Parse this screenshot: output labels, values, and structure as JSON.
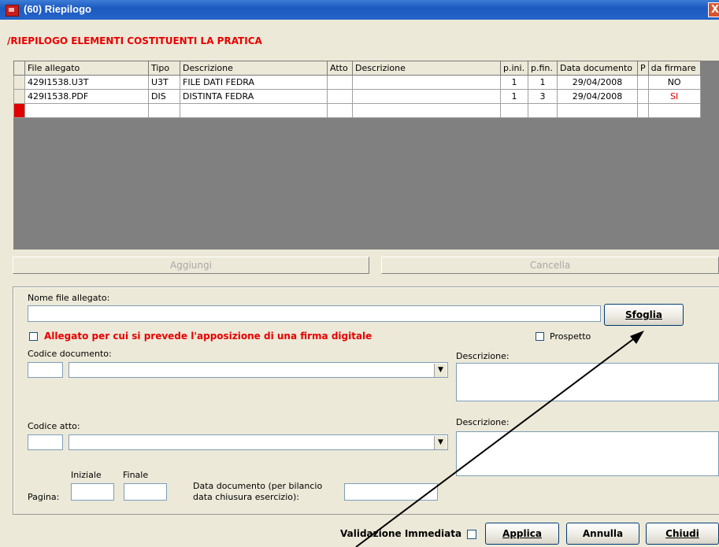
{
  "window": {
    "title": "(60) Riepilogo",
    "close": "X"
  },
  "section_title": "/RIEPILOGO ELEMENTI COSTITUENTI LA PRATICA",
  "grid": {
    "columns": [
      "File allegato",
      "Tipo",
      "Descrizione",
      "Atto",
      "Descrizione",
      "p.ini.",
      "p.fin.",
      "Data documento",
      "P",
      "da firmare"
    ],
    "rows": [
      [
        "429I1538.U3T",
        "U3T",
        "FILE DATI FEDRA",
        "",
        "",
        "1",
        "1",
        "29/04/2008",
        "",
        "NO"
      ],
      [
        "429I1538.PDF",
        "DIS",
        "DISTINTA FEDRA",
        "",
        "",
        "1",
        "3",
        "29/04/2008",
        "",
        "SI"
      ]
    ]
  },
  "buttons": {
    "aggiungi": "Aggiungi",
    "cancella": "Cancella",
    "sfoglia": "Sfoglia",
    "applica": "Applica",
    "annulla": "Annulla",
    "chiudi": "Chiudi"
  },
  "form": {
    "nome_file_label": "Nome file allegato:",
    "firma_label": "Allegato per cui si prevede l'apposizione di una firma digitale",
    "prospetto_label": "Prospetto",
    "codice_documento_label": "Codice documento:",
    "descrizione_label_1": "Descrizione:",
    "codice_atto_label": "Codice atto:",
    "descrizione_label_2": "Descrizione:",
    "iniziale_label": "Iniziale",
    "finale_label": "Finale",
    "pagina_label": "Pagina:",
    "data_documento_label_1": "Data documento (per bilancio",
    "data_documento_label_2": "data chiusura esercizio):",
    "validazione_label": "Validazione Immediata"
  },
  "colors": {
    "accent_red": "#e80000",
    "title_blue": "#2563c9"
  },
  "icons": [
    "app-icon",
    "close-icon",
    "combo-arrow-icon"
  ]
}
